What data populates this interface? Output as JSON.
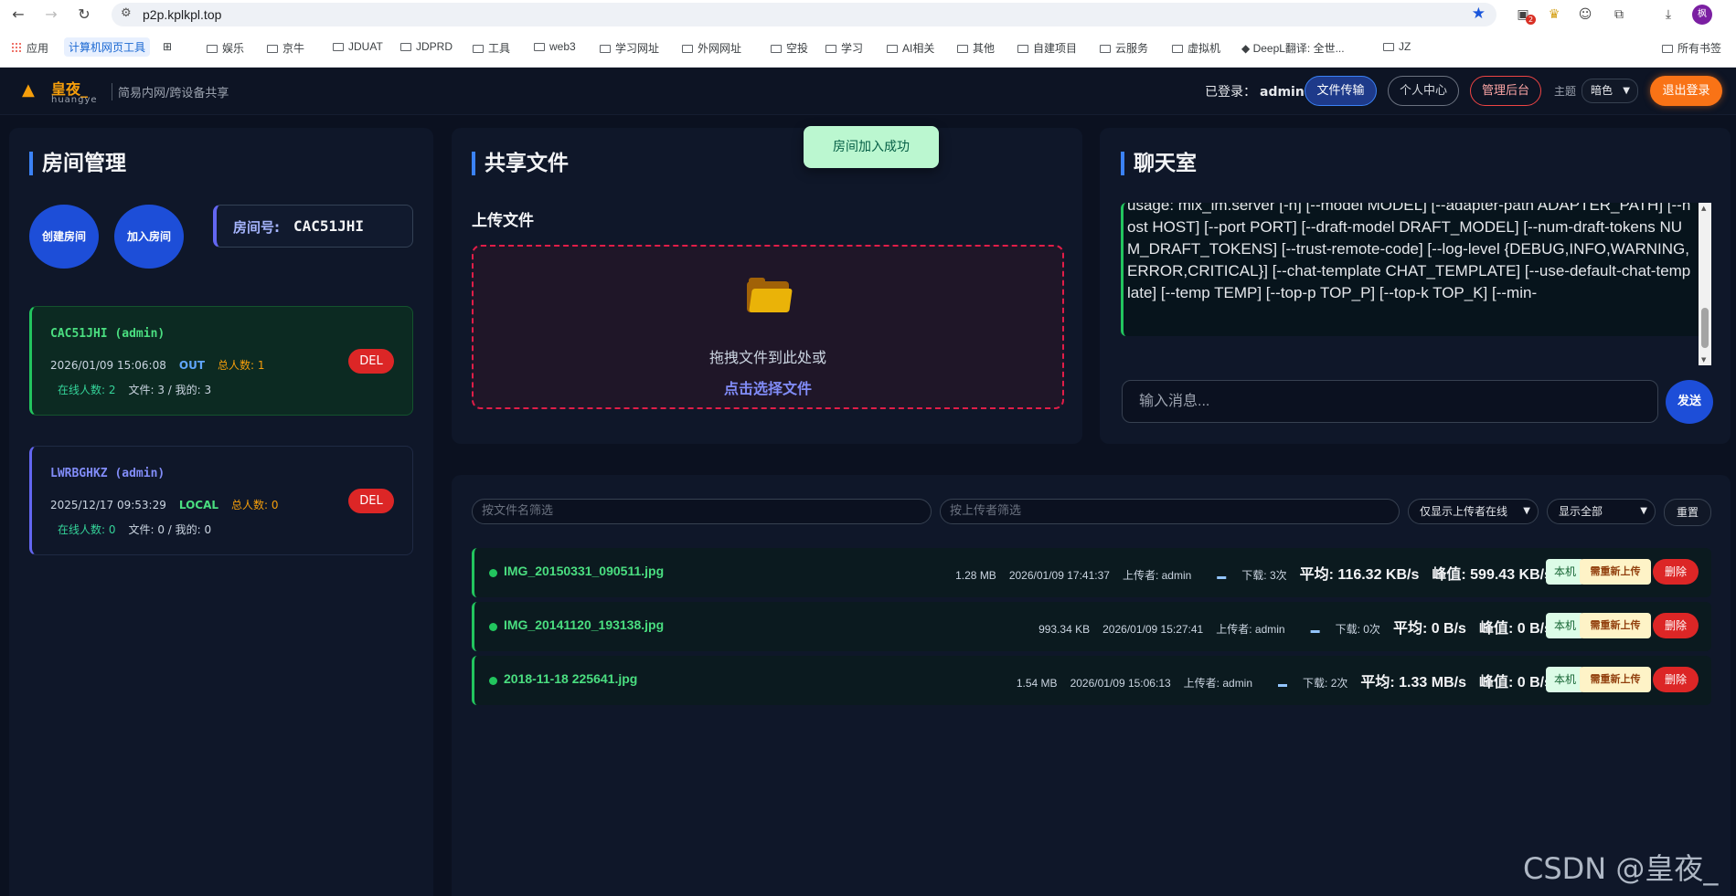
{
  "browser": {
    "url": "p2p.kplkpl.top",
    "ext_badge": "2",
    "avatar_letter": "枫",
    "bookmarks": [
      "应用",
      "计算机网页工具",
      "娱乐",
      "京牛",
      "JDUAT",
      "JDPRD",
      "工具",
      "web3",
      "学习网址",
      "外网网址",
      "空投",
      "学习",
      "AI相关",
      "其他",
      "自建项目",
      "云服务",
      "虚拟机",
      "DeepL翻译: 全世...",
      "JZ",
      "所有书签"
    ]
  },
  "header": {
    "logo_name": "皇夜_",
    "logo_sub": "huangye",
    "slogan": "简易内网/跨设备共享",
    "logged_in_label": "已登录：",
    "username": "admin",
    "btn_file": "文件传输",
    "btn_center": "个人中心",
    "btn_admin": "管理后台",
    "theme_label": "主题",
    "theme_value": "暗色",
    "btn_logout": "退出登录"
  },
  "rooms": {
    "title": "房间管理",
    "create_label": "创建房间",
    "join_label": "加入房间",
    "code_label": "房间号:",
    "code_value": "CAC51JHI",
    "list": [
      {
        "title": "CAC51JHI (admin)",
        "time": "2026/01/09 15:06:08",
        "mode": "OUT",
        "total": "总人数: 1",
        "online": "在线人数: 2",
        "files": "文件: 3 / 我的: 3",
        "del": "DEL"
      },
      {
        "title": "LWRBGHKZ (admin)",
        "time": "2025/12/17 09:53:29",
        "mode": "LOCAL",
        "total": "总人数: 0",
        "online": "在线人数: 0",
        "files": "文件: 0 / 我的: 0",
        "del": "DEL"
      }
    ]
  },
  "share": {
    "title": "共享文件",
    "upload_label": "上传文件",
    "drop_text": "拖拽文件到此处或",
    "drop_link": "点击选择文件"
  },
  "toast": "房间加入成功",
  "chat": {
    "title": "聊天室",
    "log_text": "usage: mlx_lm.server [-h] [--model MODEL] [--adapter-path ADAPTER_PATH] [--host HOST] [--port PORT] [--draft-model DRAFT_MODEL] [--num-draft-tokens NUM_DRAFT_TOKENS] [--trust-remote-code] [--log-level {DEBUG,INFO,WARNING,ERROR,CRITICAL}] [--chat-template CHAT_TEMPLATE] [--use-default-chat-template] [--temp TEMP] [--top-p TOP_P] [--top-k TOP_K] [--min-",
    "input_placeholder": "输入消息...",
    "send_label": "发送"
  },
  "files": {
    "filter_name_placeholder": "按文件名筛选",
    "filter_uploader_placeholder": "按上传者筛选",
    "select_online": "仅显示上传者在线",
    "select_show": "显示全部",
    "reset_label": "重置",
    "rows": [
      {
        "name": "IMG_20150331_090511.jpg",
        "size": "1.28 MB",
        "time": "2026/01/09 17:41:37",
        "uploader": "上传者: admin",
        "downloads": "下载: 3次",
        "avg": "平均: 116.32 KB/s",
        "peak": "峰值: 599.43 KB/s",
        "local": "本机",
        "reupload": "需重新上传",
        "delete": "删除"
      },
      {
        "name": "IMG_20141120_193138.jpg",
        "size": "993.34 KB",
        "time": "2026/01/09 15:27:41",
        "uploader": "上传者: admin",
        "downloads": "下载: 0次",
        "avg": "平均: 0 B/s",
        "peak": "峰值: 0 B/s",
        "local": "本机",
        "reupload": "需重新上传",
        "delete": "删除"
      },
      {
        "name": "2018-11-18 225641.jpg",
        "size": "1.54 MB",
        "time": "2026/01/09 15:06:13",
        "uploader": "上传者: admin",
        "downloads": "下载: 2次",
        "avg": "平均: 1.33 MB/s",
        "peak": "峰值: 0 B/s",
        "local": "本机",
        "reupload": "需重新上传",
        "delete": "删除"
      }
    ]
  },
  "watermark": "CSDN @皇夜_",
  "colors": {
    "accent": "#1d4ed8",
    "success": "#22c55e",
    "danger": "#dc2626",
    "warning": "#f59e0b",
    "logout": "#f97316"
  }
}
